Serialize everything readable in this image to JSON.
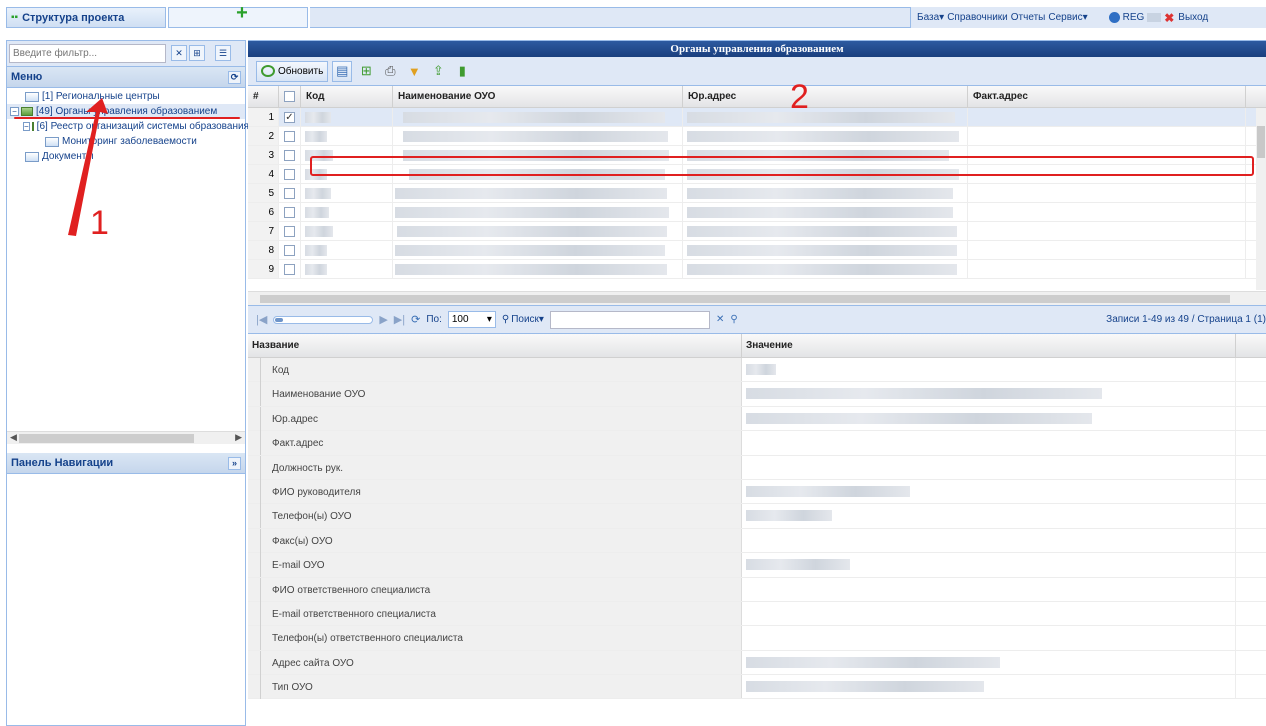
{
  "topbar": {
    "tab_label": "Структура проекта",
    "menu": [
      "База▾",
      "Справочники",
      "Отчеты",
      "Сервис▾"
    ],
    "user_label": "REG",
    "exit_label": "Выход"
  },
  "left": {
    "filter_placeholder": "Введите фильтр...",
    "menu_title": "Меню",
    "tree": [
      {
        "label": "[1] Региональные центры"
      },
      {
        "label": "[49] Органы управления образованием"
      },
      {
        "label": "[6] Реестр организаций системы образования"
      },
      {
        "label": "Мониторинг заболеваемости"
      },
      {
        "label": "Документы"
      }
    ],
    "nav_panel_title": "Панель Навигации"
  },
  "main": {
    "title": "Органы управления образованием",
    "refresh_label": "Обновить",
    "columns": [
      "#",
      "Код",
      "Наименование ОУО",
      "Юр.адрес",
      "Факт.адрес"
    ],
    "row_numbers": [
      "1",
      "2",
      "3",
      "4",
      "5",
      "6",
      "7",
      "8",
      "9"
    ],
    "pager": {
      "page_size_label": "По:",
      "page_size": "100",
      "search_label": "Поиск▾",
      "info": "Записи 1-49 из 49 / Страница 1 (1)"
    },
    "props_headers": [
      "Название",
      "Значение"
    ],
    "props": [
      "Код",
      "Наименование ОУО",
      "Юр.адрес",
      "Факт.адрес",
      "Должность рук.",
      "ФИО руководителя",
      "Телефон(ы) ОУО",
      "Факс(ы) ОУО",
      "E-mail ОУО",
      "ФИО ответственного специалиста",
      "E-mail ответственного специалиста",
      "Телефон(ы) ответственного специалиста",
      "Адрес сайта ОУО",
      "Тип ОУО"
    ]
  },
  "annotations": {
    "one": "1",
    "two": "2"
  },
  "colors": {
    "accent": "#99bbe8",
    "header": "#1a3f7e",
    "annotation": "#e02020"
  }
}
